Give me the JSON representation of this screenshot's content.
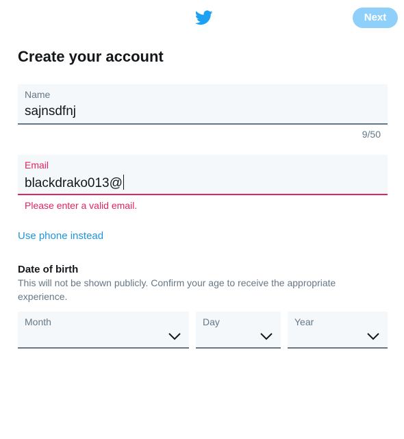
{
  "header": {
    "logo_icon": "twitter-bird-icon",
    "next_label": "Next",
    "brand_color": "#1da1f2"
  },
  "page": {
    "title": "Create your account"
  },
  "name_field": {
    "label": "Name",
    "value": "sajnsdfnj",
    "counter": "9/50"
  },
  "email_field": {
    "label": "Email",
    "value": "blackdrako013@",
    "error": "Please enter a valid email.",
    "error_color": "#e0245e"
  },
  "links": {
    "use_phone": "Use phone instead"
  },
  "dob": {
    "title": "Date of birth",
    "description": "This will not be shown publicly. Confirm your age to receive the appropriate experience.",
    "month_label": "Month",
    "day_label": "Day",
    "year_label": "Year"
  }
}
